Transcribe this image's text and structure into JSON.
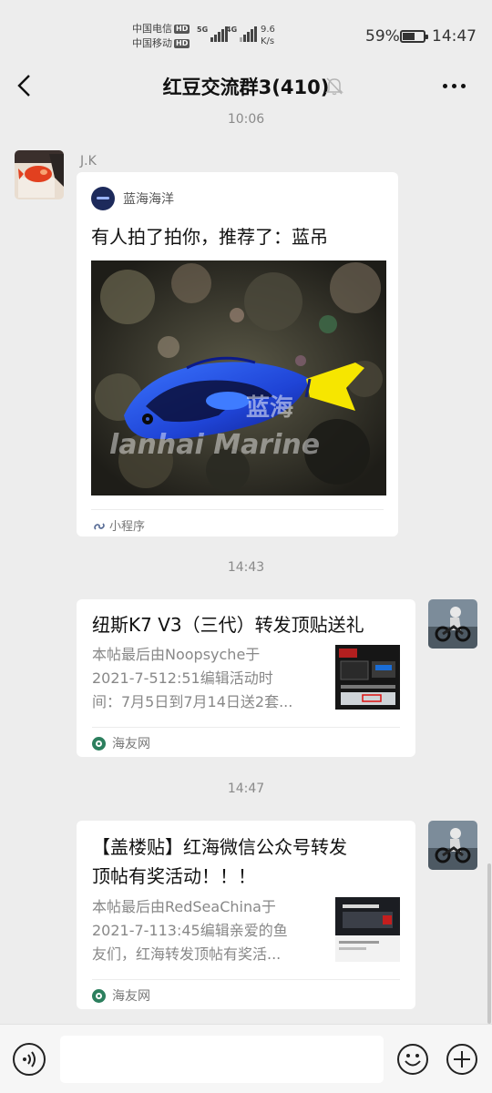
{
  "status_bar": {
    "carrier1": "中国电信",
    "carrier2": "中国移动",
    "hd": "HD",
    "net1": "5G",
    "net2": "4G",
    "speed_value": "9.6",
    "speed_unit": "K/s",
    "battery_pct": "59%",
    "battery_level": 0.59,
    "time": "14:47"
  },
  "nav": {
    "title": "红豆交流群3(410)"
  },
  "chat": {
    "timestamps": [
      "10:06",
      "14:43",
      "14:47"
    ],
    "msg1": {
      "sender": "J.K",
      "brand": "蓝海海洋",
      "title": "有人拍了拍你，推荐了：蓝吊",
      "watermark_cn": "蓝海",
      "watermark_en": "lanhai Marine",
      "footer": "小程序"
    },
    "msg2": {
      "title": "纽斯K7 V3（三代）转发顶贴送礼",
      "desc_lines": [
        "本帖最后由Noopsyche于",
        "2021-7-512:51编辑活动时",
        "间：7月5日到7月14日送2套..."
      ],
      "source": "海友网"
    },
    "msg3": {
      "title_lines": [
        "【盖楼贴】红海微信公众号转发",
        "顶帖有奖活动！！！"
      ],
      "desc_lines": [
        "本帖最后由RedSeaChina于",
        "2021-7-113:45编辑亲爱的鱼",
        "友们，红海转发顶帖有奖活..."
      ],
      "source": "海友网"
    }
  },
  "input": {
    "placeholder": ""
  },
  "colors": {
    "background": "#ededed",
    "bubble": "#ffffff",
    "meta_text": "#8a8a8a"
  }
}
